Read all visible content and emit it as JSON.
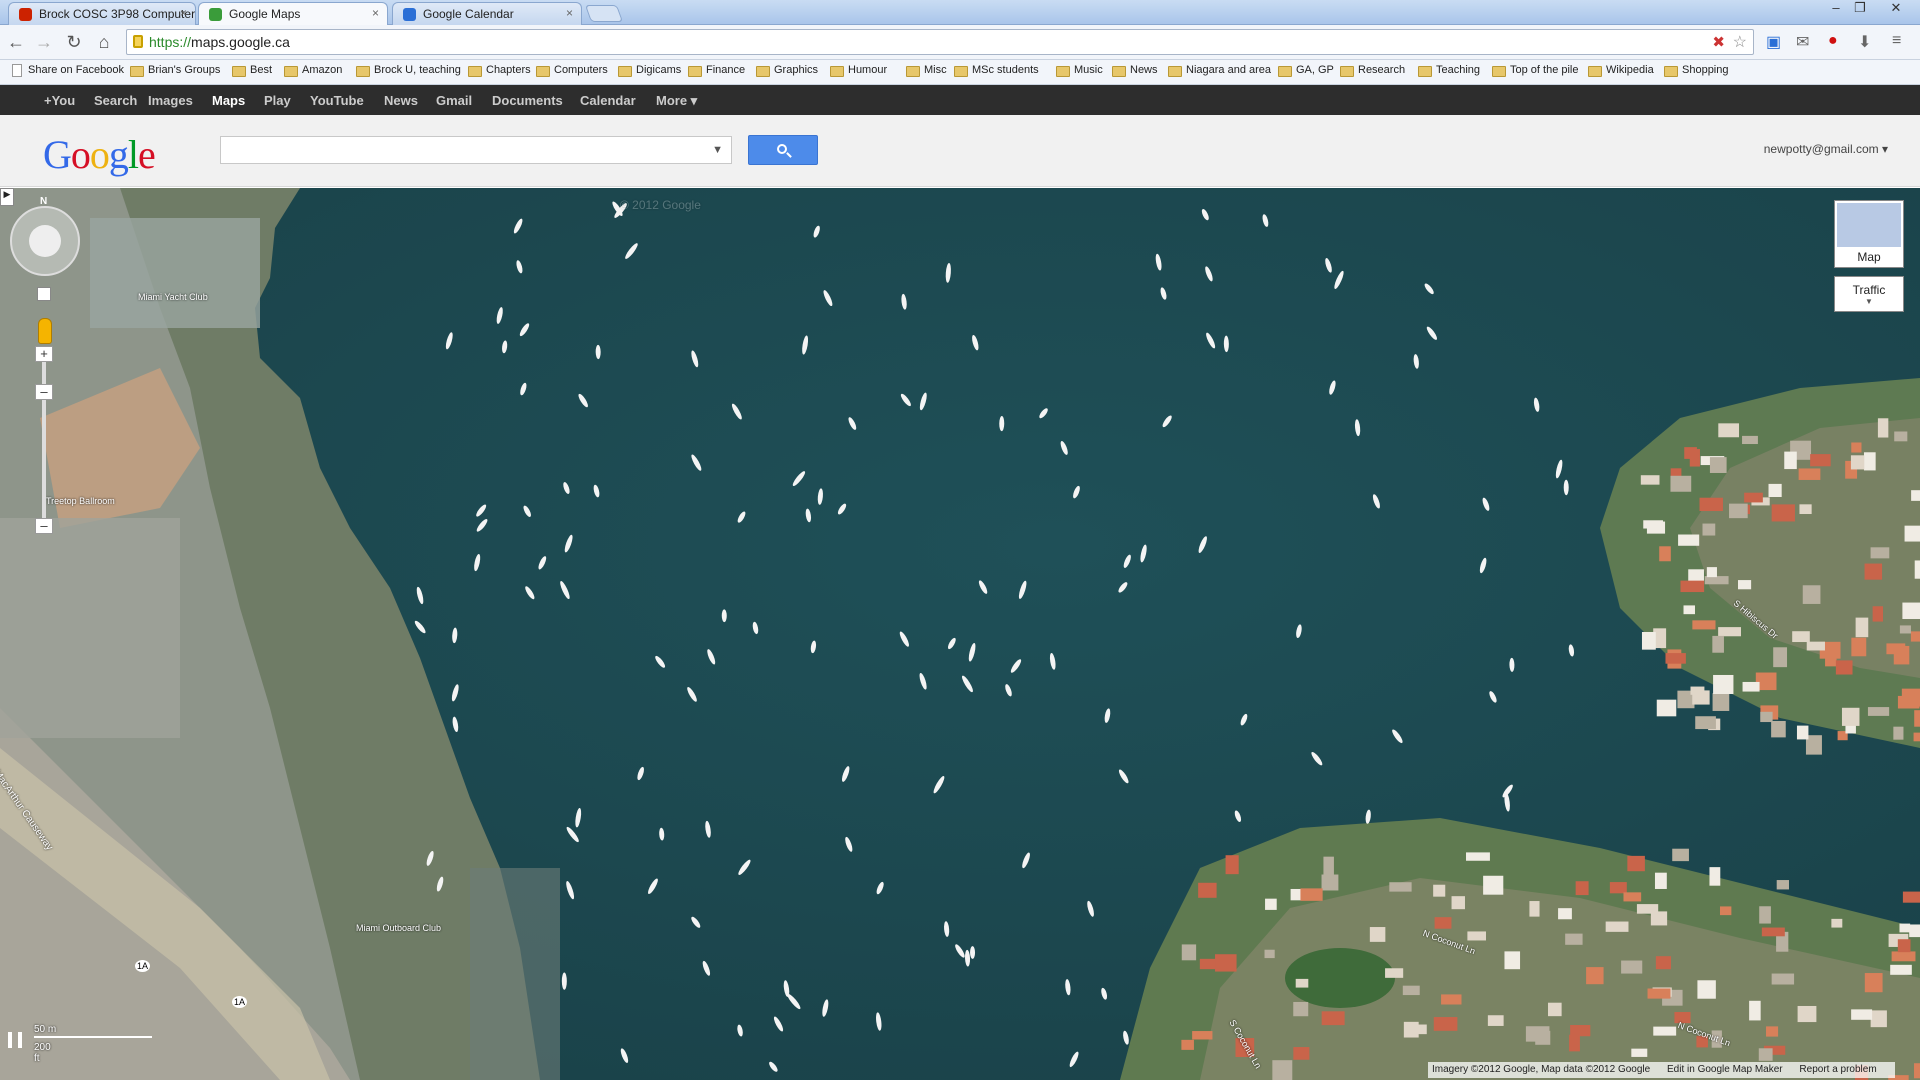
{
  "browser": {
    "tabs": [
      {
        "label": "Brock COSC 3P98 Computer",
        "color": "#cc2200"
      },
      {
        "label": "Google Maps",
        "color": "#3a9c3a"
      },
      {
        "label": "Google Calendar",
        "color": "#2b6fd6"
      }
    ],
    "url_scheme": "https://",
    "url_host": "maps.google.ca",
    "bookmarks": [
      "Share on Facebook",
      "Brian's Groups",
      "Best",
      "Amazon",
      "Brock U, teaching",
      "Chapters",
      "Computers",
      "Digicams",
      "Finance",
      "Graphics",
      "Humour",
      "Misc",
      "MSc students",
      "Music",
      "News",
      "Niagara and area",
      "GA, GP",
      "Research",
      "Teaching",
      "Top of the pile",
      "Wikipedia",
      "Shopping"
    ]
  },
  "gbar": {
    "items": [
      "+You",
      "Search",
      "Images",
      "Maps",
      "Play",
      "YouTube",
      "News",
      "Gmail",
      "Documents",
      "Calendar",
      "More ▾"
    ],
    "selected": "Maps"
  },
  "header": {
    "logo": "Google",
    "search_placeholder": "",
    "account": "newpotty@gmail.com ▾"
  },
  "map": {
    "compass_n": "N",
    "map_type_label": "Map",
    "traffic_label": "Traffic",
    "labels": {
      "yacht_club": "Miami Yacht Club",
      "treetop": "Treetop Ballroom",
      "outboard": "Miami Outboard Club",
      "causeway": "MacArthur Causeway",
      "hibiscus": "S Hibiscus Dr",
      "coconut1": "N Coconut Ln",
      "coconut2": "N Coconut Ln",
      "coconut3": "S Coconut Ln",
      "route1": "1A",
      "route2": "1A",
      "watermark": "© 2012 Google"
    },
    "scale_metric": "50 m",
    "scale_imperial": "200 ft",
    "copyright": "Imagery ©2012 Google, Map data ©2012 Google",
    "edit_link": "Edit in Google Map Maker",
    "report_link": "Report a problem"
  },
  "colors": {
    "water": "#1f4c54",
    "land": "#6b7a5e",
    "gbar_bg": "#2d2d2d",
    "search_button": "#4d8bea"
  }
}
